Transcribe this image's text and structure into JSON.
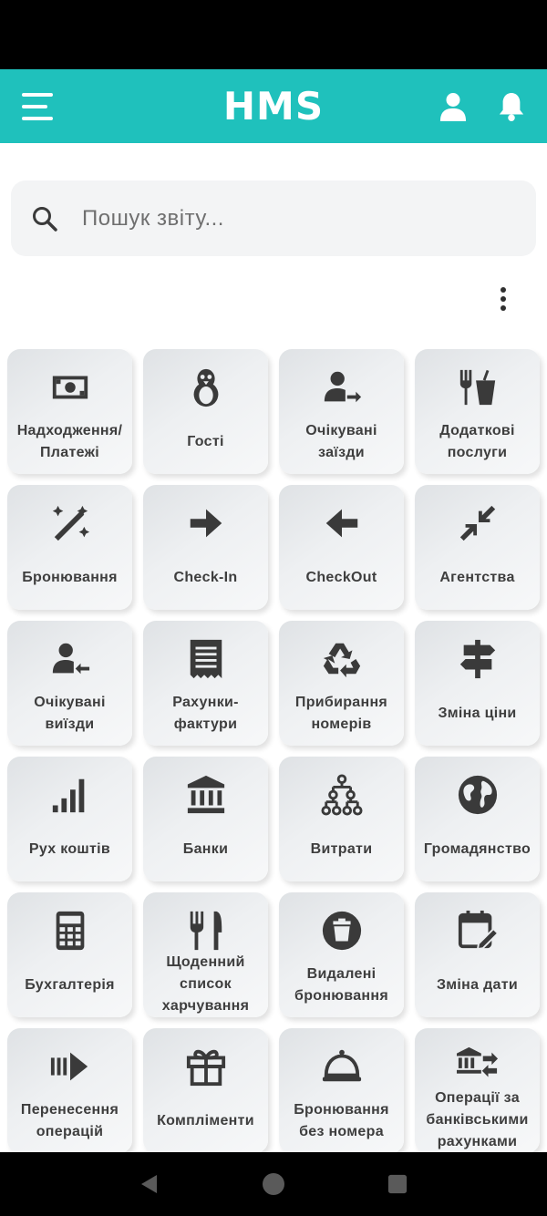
{
  "app": {
    "logo": "HMS"
  },
  "header": {
    "menu_icon": "hamburger-menu-icon",
    "profile_icon": "person-icon",
    "notifications_icon": "bell-icon"
  },
  "search": {
    "placeholder": "Пошук звіту..."
  },
  "colors": {
    "accent": "#1fc1bc",
    "icon": "#3a3a3a"
  },
  "tiles": [
    {
      "label": "Надходження/ Платежі",
      "icon": "money-icon"
    },
    {
      "label": "Гості",
      "icon": "penguin-icon"
    },
    {
      "label": "Очікувані заїзди",
      "icon": "user-arrow-right-icon"
    },
    {
      "label": "Додаткові послуги",
      "icon": "fork-cup-icon"
    },
    {
      "label": "Бронювання",
      "icon": "magic-wand-icon"
    },
    {
      "label": "Check-In",
      "icon": "arrow-right-icon"
    },
    {
      "label": "CheckOut",
      "icon": "arrow-left-icon"
    },
    {
      "label": "Агентства",
      "icon": "compress-icon"
    },
    {
      "label": "Очікувані виїзди",
      "icon": "user-arrow-left-icon"
    },
    {
      "label": "Рахунки- фактури",
      "icon": "receipt-icon"
    },
    {
      "label": "Прибирання номерів",
      "icon": "recycle-icon"
    },
    {
      "label": "Зміна ціни",
      "icon": "signpost-icon"
    },
    {
      "label": "Рух коштів",
      "icon": "signal-bars-icon"
    },
    {
      "label": "Банки",
      "icon": "bank-icon"
    },
    {
      "label": "Витрати",
      "icon": "hierarchy-icon"
    },
    {
      "label": "Громадянство",
      "icon": "globe-icon"
    },
    {
      "label": "Бухгалтерія",
      "icon": "calculator-icon"
    },
    {
      "label": "Щоденний список харчування",
      "icon": "utensils-icon"
    },
    {
      "label": "Видалені бронювання",
      "icon": "trash-circle-icon"
    },
    {
      "label": "Зміна дати",
      "icon": "calendar-edit-icon"
    },
    {
      "label": "Перенесення операцій",
      "icon": "forward-bars-icon"
    },
    {
      "label": "Компліменти",
      "icon": "gift-icon"
    },
    {
      "label": "Бронювання без номера",
      "icon": "cloche-icon"
    },
    {
      "label": "Операції за банківськими рахунками",
      "icon": "bank-transfer-icon"
    }
  ],
  "navigation": {
    "back_icon": "back-triangle-icon",
    "home_icon": "home-circle-icon",
    "recents_icon": "recents-square-icon"
  }
}
